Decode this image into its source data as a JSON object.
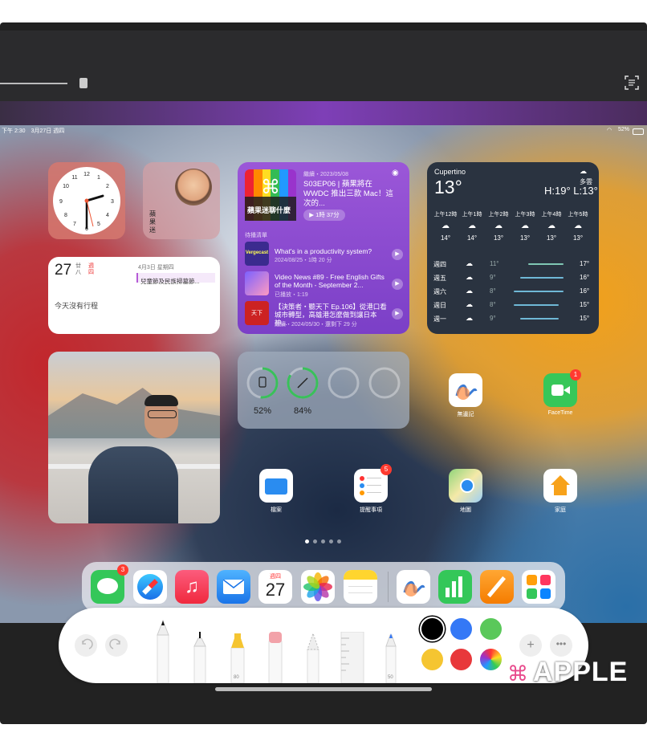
{
  "status_bar": {
    "left": "下午 2:30　3月27日 週四",
    "battery": "52%"
  },
  "calendar_widget": {
    "day": "27",
    "lunar": "廿\n八",
    "weekday": "週\n四",
    "date_line": "4月3日 星期四",
    "event": "兒童節及民族掃墓節...",
    "empty": "今天沒有行程"
  },
  "memoji_widget": {
    "name": "蘋果迷"
  },
  "podcast_widget": {
    "cover_text": "蘋果迷聊什麼",
    "meta": "繼續・2023/05/08",
    "title": "S03EP06 | 蘋果將在 WWDC 推出三款 Mac！這次的...",
    "play_label": "1時 37分",
    "queue_header": "待播清單",
    "queue": [
      {
        "title": "What's in a productivity system?",
        "meta": "2024/08/25・1時 20 分",
        "cover": "Vergecast"
      },
      {
        "title": "Video News #89 - Free English Gifts of the Month - September 2...",
        "meta": "已播放・1:19",
        "cover": ""
      },
      {
        "title": "【決策者・聽天下 Ep.106】從港口看城市轉型，高雄港怎麼做到讓日本神...",
        "meta": "繼續・2024/05/30・還剩下 29 分",
        "cover": "天下"
      }
    ]
  },
  "weather_widget": {
    "city": "Cupertino",
    "temp": "13°",
    "condition": "多雲",
    "hl": "H:19° L:13°",
    "hourly": [
      {
        "time": "上午12時",
        "temp": "14°"
      },
      {
        "time": "上午1時",
        "temp": "14°"
      },
      {
        "time": "上午2時",
        "temp": "13°"
      },
      {
        "time": "上午3時",
        "temp": "13°"
      },
      {
        "time": "上午4時",
        "temp": "13°"
      },
      {
        "time": "上午5時",
        "temp": "13°"
      }
    ],
    "daily": [
      {
        "day": "週四",
        "low": "11°",
        "high": "17°"
      },
      {
        "day": "週五",
        "low": "9°",
        "high": "16°"
      },
      {
        "day": "週六",
        "low": "8°",
        "high": "16°"
      },
      {
        "day": "週日",
        "low": "8°",
        "high": "15°"
      },
      {
        "day": "週一",
        "low": "9°",
        "high": "15°"
      }
    ]
  },
  "battery_widget": {
    "ipad": "52%",
    "pencil": "84%",
    "ipad_level": 0.52,
    "pencil_level": 0.84
  },
  "apps": {
    "freeform": "無邊記",
    "facetime": "FaceTime",
    "facetime_badge": "1",
    "files": "檔案",
    "reminders": "提醒事項",
    "reminders_badge": "5",
    "maps": "地圖",
    "home": "家庭"
  },
  "dock": {
    "messages_badge": "3",
    "calendar_weekday": "週四",
    "calendar_day": "27"
  },
  "toolbar": {
    "pencil_label": "80",
    "marker_label": "50"
  },
  "colors": {
    "black": "#000000",
    "blue": "#3478f6",
    "green": "#5ac85a",
    "yellow": "#f5c531",
    "red": "#e8383b"
  },
  "logo": "APPLE"
}
